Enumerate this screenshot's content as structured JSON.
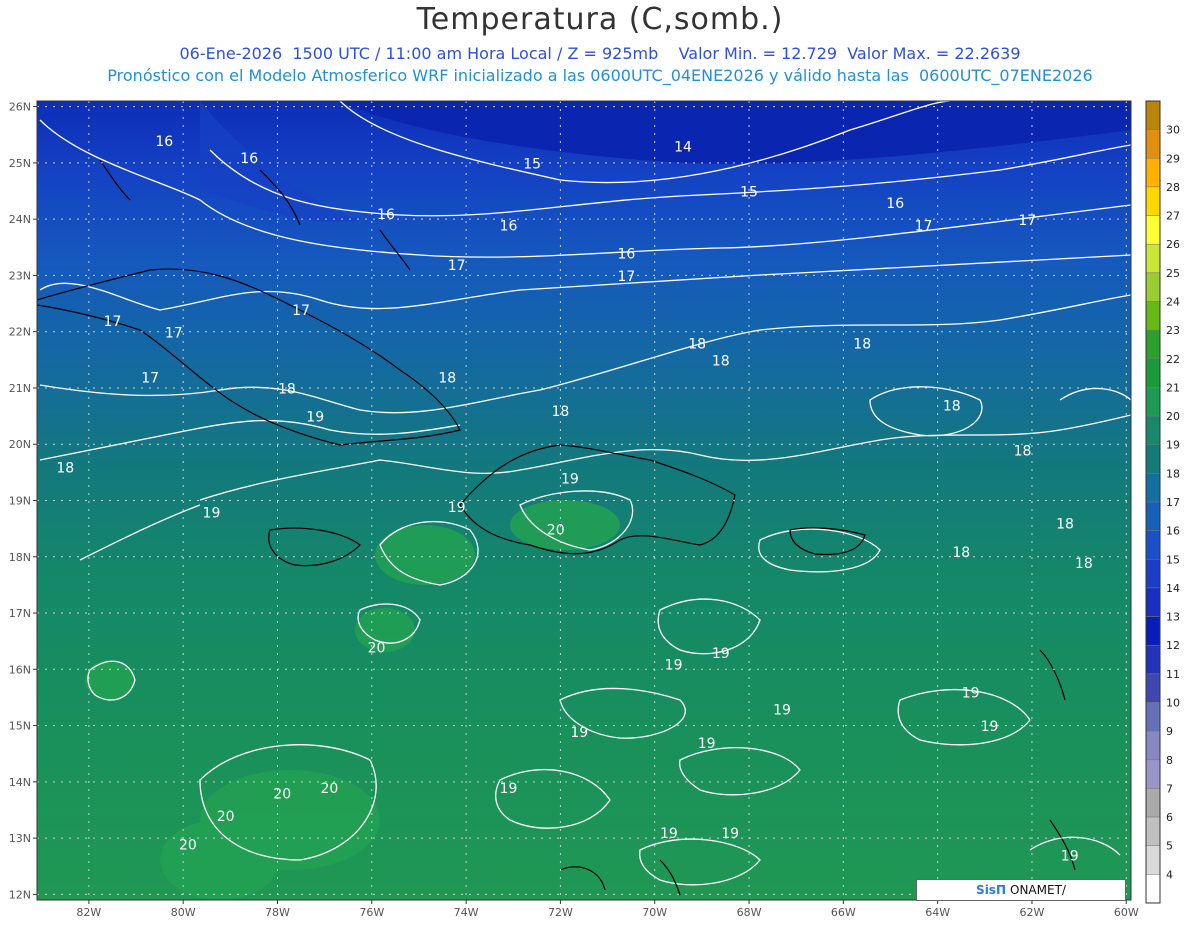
{
  "header": {
    "title": "Temperatura (C,somb.)",
    "line1": "06-Ene-2026  1500 UTC / 11:00 am Hora Local / Z = 925mb    Valor Min. = 12.729  Valor Max. = 22.2639",
    "line2": "Pronóstico con el Modelo Atmosferico WRF inicializado a las 0600UTC_04ENE2026 y válido hasta las  0600UTC_07ENE2026"
  },
  "axes": {
    "lat_labels": [
      "26N",
      "25N",
      "24N",
      "23N",
      "22N",
      "21N",
      "20N",
      "19N",
      "18N",
      "17N",
      "16N",
      "15N",
      "14N",
      "13N",
      "12N"
    ],
    "lon_labels": [
      "82W",
      "80W",
      "78W",
      "76W",
      "74W",
      "72W",
      "70W",
      "68W",
      "66W",
      "64W",
      "62W",
      "60W"
    ]
  },
  "colorbar": {
    "labels": [
      "30",
      "29",
      "28",
      "27",
      "26",
      "25",
      "24",
      "23",
      "22",
      "21",
      "20",
      "19",
      "18",
      "17",
      "16",
      "15",
      "14",
      "13",
      "12",
      "11",
      "10",
      "9",
      "8",
      "7",
      "6",
      "5",
      "4"
    ],
    "colors": [
      "#b8860b",
      "#e08f10",
      "#ffb000",
      "#ffd700",
      "#ffff33",
      "#c8e633",
      "#9acd32",
      "#66b814",
      "#2ca02c",
      "#1a9a3a",
      "#1f9a55",
      "#17886a",
      "#147a78",
      "#146fa0",
      "#1660b8",
      "#1a50c8",
      "#1a3ec8",
      "#1a2fc0",
      "#0a1db8",
      "#2434b8",
      "#4048b0",
      "#6470b8",
      "#8888c0",
      "#9a94c8",
      "#aaaaaa",
      "#c0c0c0",
      "#d9d9d9",
      "#ffffff"
    ]
  },
  "contour_labels": [
    {
      "text": "14",
      "lon": -69.4,
      "lat": 25.2
    },
    {
      "text": "15",
      "lon": -72.6,
      "lat": 24.9
    },
    {
      "text": "15",
      "lon": -68.0,
      "lat": 24.4
    },
    {
      "text": "16",
      "lon": -80.4,
      "lat": 25.3
    },
    {
      "text": "16",
      "lon": -78.6,
      "lat": 25.0
    },
    {
      "text": "16",
      "lon": -75.7,
      "lat": 24.0
    },
    {
      "text": "16",
      "lon": -73.1,
      "lat": 23.8
    },
    {
      "text": "16",
      "lon": -70.6,
      "lat": 23.3
    },
    {
      "text": "16",
      "lon": -64.9,
      "lat": 24.2
    },
    {
      "text": "17",
      "lon": -74.2,
      "lat": 23.1
    },
    {
      "text": "17",
      "lon": -70.6,
      "lat": 22.9
    },
    {
      "text": "17",
      "lon": -64.3,
      "lat": 23.8
    },
    {
      "text": "17",
      "lon": -62.1,
      "lat": 23.9
    },
    {
      "text": "17",
      "lon": -77.5,
      "lat": 22.3
    },
    {
      "text": "17",
      "lon": -81.5,
      "lat": 22.1
    },
    {
      "text": "17",
      "lon": -80.2,
      "lat": 21.9
    },
    {
      "text": "17",
      "lon": -80.7,
      "lat": 21.1
    },
    {
      "text": "18",
      "lon": -69.1,
      "lat": 21.7
    },
    {
      "text": "18",
      "lon": -68.6,
      "lat": 21.4
    },
    {
      "text": "18",
      "lon": -65.6,
      "lat": 21.7
    },
    {
      "text": "18",
      "lon": -77.8,
      "lat": 20.9
    },
    {
      "text": "18",
      "lon": -74.4,
      "lat": 21.1
    },
    {
      "text": "18",
      "lon": -72.0,
      "lat": 20.5
    },
    {
      "text": "18",
      "lon": -63.7,
      "lat": 20.6
    },
    {
      "text": "18",
      "lon": -62.2,
      "lat": 19.8
    },
    {
      "text": "18",
      "lon": -82.5,
      "lat": 19.5
    },
    {
      "text": "18",
      "lon": -61.3,
      "lat": 18.5
    },
    {
      "text": "18",
      "lon": -63.5,
      "lat": 18.0
    },
    {
      "text": "18",
      "lon": -60.9,
      "lat": 17.8
    },
    {
      "text": "19",
      "lon": -77.2,
      "lat": 20.4
    },
    {
      "text": "19",
      "lon": -79.4,
      "lat": 18.7
    },
    {
      "text": "19",
      "lon": -74.2,
      "lat": 18.8
    },
    {
      "text": "19",
      "lon": -71.8,
      "lat": 19.3
    },
    {
      "text": "19",
      "lon": -68.6,
      "lat": 16.2
    },
    {
      "text": "19",
      "lon": -69.6,
      "lat": 16.0
    },
    {
      "text": "19",
      "lon": -63.3,
      "lat": 15.5
    },
    {
      "text": "19",
      "lon": -67.3,
      "lat": 15.2
    },
    {
      "text": "19",
      "lon": -62.9,
      "lat": 14.9
    },
    {
      "text": "19",
      "lon": -71.6,
      "lat": 14.8
    },
    {
      "text": "19",
      "lon": -68.9,
      "lat": 14.6
    },
    {
      "text": "19",
      "lon": -73.1,
      "lat": 13.8
    },
    {
      "text": "19",
      "lon": -69.7,
      "lat": 13.0
    },
    {
      "text": "19",
      "lon": -68.4,
      "lat": 13.0
    },
    {
      "text": "19",
      "lon": -61.2,
      "lat": 12.6
    },
    {
      "text": "20",
      "lon": -72.1,
      "lat": 18.4
    },
    {
      "text": "20",
      "lon": -75.9,
      "lat": 16.3
    },
    {
      "text": "20",
      "lon": -77.9,
      "lat": 13.7
    },
    {
      "text": "20",
      "lon": -76.9,
      "lat": 13.8
    },
    {
      "text": "20",
      "lon": -79.1,
      "lat": 13.3
    },
    {
      "text": "20",
      "lon": -79.9,
      "lat": 12.8
    }
  ],
  "logo": {
    "brand": "SisΠ",
    "text": "ONAMET/"
  }
}
